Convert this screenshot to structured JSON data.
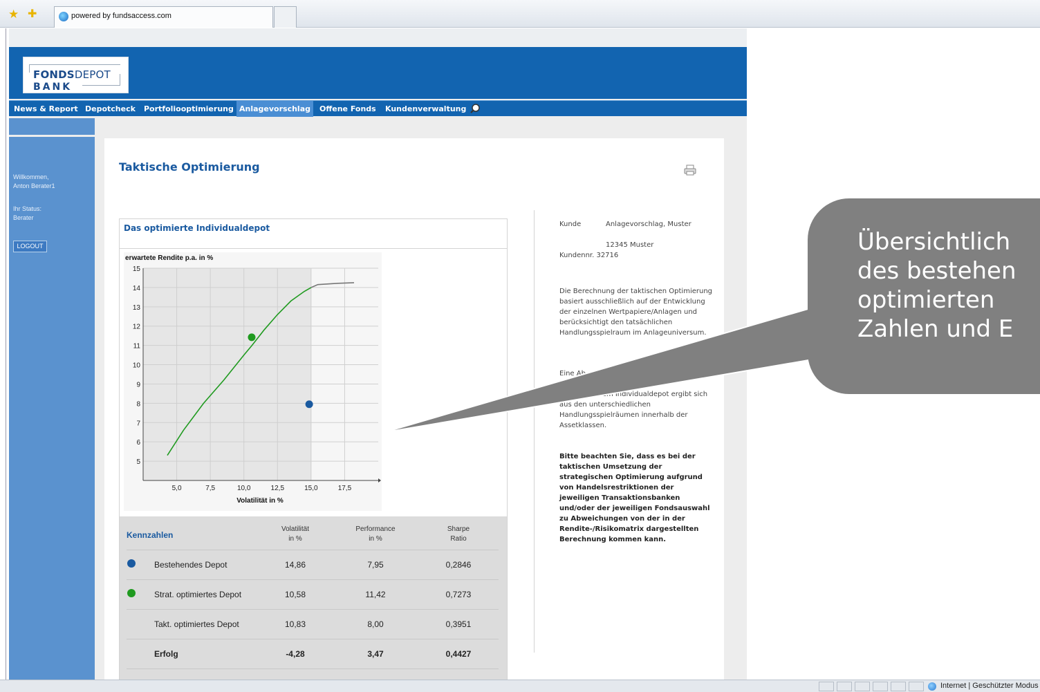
{
  "browser": {
    "tab_title": "powered by fundsaccess.com",
    "status_zone": "Internet | Geschützter Modus"
  },
  "site": {
    "logo": {
      "line1_bold": "FONDS",
      "line1_light": "DEPOT",
      "line2": "BANK"
    },
    "nav": [
      {
        "label": "News & Report",
        "active": false
      },
      {
        "label": "Depotcheck",
        "active": false
      },
      {
        "label": "Portfoliooptimierung",
        "active": false
      },
      {
        "label": "Anlagevorschlag",
        "active": true
      },
      {
        "label": "Offene Fonds",
        "active": false
      },
      {
        "label": "Kundenverwaltung",
        "active": false
      }
    ],
    "sidebar": {
      "welcome_line1": "Willkommen,",
      "welcome_line2": "Anton Berater1",
      "status_line1": "Ihr Status:",
      "status_line2": "Berater",
      "logout": "LOGOUT"
    }
  },
  "page": {
    "title": "Taktische Optimierung",
    "panel_title": "Das optimierte Individualdepot"
  },
  "chart_data": {
    "type": "scatter",
    "ylabel": "erwartete Rendite p.a. in %",
    "xlabel": "Volatilität in %",
    "xlim": [
      2.5,
      20
    ],
    "ylim": [
      4,
      15
    ],
    "x_ticks": [
      "5,0",
      "7,5",
      "10,0",
      "12,5",
      "15,0",
      "17,5"
    ],
    "y_ticks": [
      "5",
      "6",
      "7",
      "8",
      "9",
      "10",
      "11",
      "12",
      "13",
      "14",
      "15"
    ],
    "frontier": {
      "color": "#1f9a1f",
      "points": [
        [
          4.3,
          5.3
        ],
        [
          5.5,
          6.6
        ],
        [
          7.0,
          8.0
        ],
        [
          8.5,
          9.2
        ],
        [
          10.0,
          10.5
        ],
        [
          10.6,
          11.0
        ],
        [
          11.5,
          11.8
        ],
        [
          12.5,
          12.6
        ],
        [
          13.5,
          13.3
        ],
        [
          14.5,
          13.8
        ],
        [
          15.0,
          14.0
        ]
      ]
    },
    "frontier_ext": {
      "color": "#777777",
      "points": [
        [
          15.0,
          14.0
        ],
        [
          15.5,
          14.15
        ],
        [
          17.0,
          14.22
        ],
        [
          18.2,
          14.25
        ]
      ]
    },
    "shaded_until_x": 15.0,
    "points": [
      {
        "label": "Bestehendes Depot",
        "x": 14.86,
        "y": 7.95,
        "color": "#1a5aa0"
      },
      {
        "label": "Strat. optimiertes Depot",
        "x": 10.58,
        "y": 11.42,
        "color": "#1f9a1f"
      }
    ],
    "grid": true
  },
  "kennzahlen": {
    "title": "Kennzahlen",
    "headers": [
      {
        "line1": "Volatilität",
        "line2": "in %"
      },
      {
        "line1": "Performance",
        "line2": "in %"
      },
      {
        "line1": "Sharpe",
        "line2": "Ratio"
      }
    ],
    "rows": [
      {
        "name": "Bestehendes Depot",
        "vol": "14,86",
        "perf": "7,95",
        "sharpe": "0,2846",
        "marker": "#1a5aa0"
      },
      {
        "name": "Strat. optimiertes Depot",
        "vol": "10,58",
        "perf": "11,42",
        "sharpe": "0,7273",
        "marker": "#1f9a1f"
      },
      {
        "name": "Takt. optimiertes Depot",
        "vol": "10,83",
        "perf": "8,00",
        "sharpe": "0,3951",
        "marker": ""
      },
      {
        "name": "Erfolg",
        "vol": "-4,28",
        "perf": "3,47",
        "sharpe": "0,4427",
        "marker": "",
        "bold": true
      }
    ]
  },
  "info": {
    "kunde_label": "Kunde",
    "kunde_value": "Anlagevorschlag, Muster",
    "address": "12345 Muster",
    "kundennr": "Kundennr. 32716",
    "para1": "Die Berechnung der taktischen Optimierung basiert ausschließlich auf der Entwicklung der einzelnen Wertpapiere/Anlagen und berücksichtigt den tatsächlichen Handlungsspielraum im Anlageuniversum.",
    "para2_start": "Eine Ab",
    "para2_rest": "und taktischem Individualdepot ergibt sich aus den unterschiedlichen Handlungsspielräumen innerhalb der Assetklassen.",
    "warning": "Bitte beachten Sie, dass es bei der taktischen Umsetzung der strategischen Optimierung aufgrund von Handelsrestriktionen der jeweiligen Transaktionsbanken und/oder der jeweiligen Fondsauswahl zu Abweichungen von der in der Rendite-/Risikomatrix dargestellten Berechnung kommen kann."
  },
  "callout": {
    "lines": [
      "Übersichtlich",
      "des bestehen",
      "optimierten",
      "Zahlen und E"
    ],
    "color": "#808080"
  }
}
